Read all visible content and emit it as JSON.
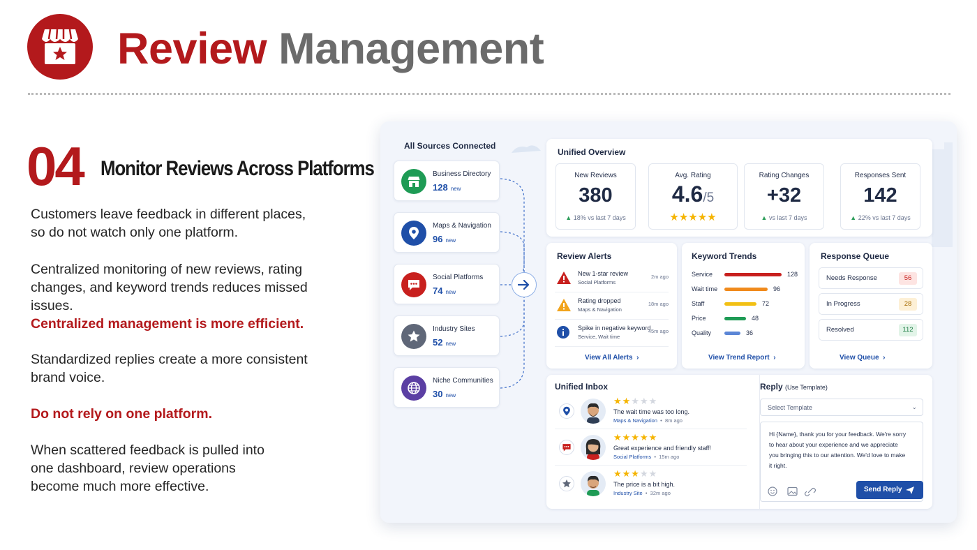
{
  "header": {
    "title_part1": "Review",
    "title_part2": "Management",
    "logo_icon": "storefront-star-icon"
  },
  "section": {
    "number": "04",
    "heading": "Monitor Reviews Across Platforms"
  },
  "paragraphs": {
    "p1": "Customers leave feedback in different places, so do not watch only one platform.",
    "p2": "Centralized monitoring of new reviews, rating changes, and keyword trends reduces missed issues.",
    "p2_emphasis": "Centralized management is more efficient.",
    "p3": "Standardized replies create a more consistent brand voice.",
    "p4_emphasis": "Do not rely on one platform.",
    "p5": "When scattered feedback is pulled into one dashboard, review operations become much more effective."
  },
  "colors": {
    "brand_red": "#b3191c",
    "accent_blue": "#1f4fa8",
    "star": "#f5b400",
    "green": "#2e9e5b"
  },
  "sources": {
    "title": "All Sources Connected",
    "new_label": "new",
    "items": [
      {
        "name": "Business Directory",
        "count": "128",
        "icon": "storefront-icon",
        "color": "#1e9b55"
      },
      {
        "name": "Maps & Navigation",
        "count": "96",
        "icon": "map-pin-icon",
        "color": "#1f4fa8"
      },
      {
        "name": "Social Platforms",
        "count": "74",
        "icon": "chat-bubble-icon",
        "color": "#c8201e"
      },
      {
        "name": "Industry Sites",
        "count": "52",
        "icon": "star-icon",
        "color": "#5f6778"
      },
      {
        "name": "Niche Communities",
        "count": "30",
        "icon": "globe-icon",
        "color": "#5b3fa3"
      }
    ]
  },
  "overview": {
    "title": "Unified Overview",
    "metrics": [
      {
        "label": "New Reviews",
        "value": "380",
        "delta": "18%",
        "delta_suffix": "vs last 7 days"
      },
      {
        "label": "Avg. Rating",
        "value": "4.6",
        "value_suffix": "/5",
        "stars": "★★★★★",
        "rating": 4.6
      },
      {
        "label": "Rating Changes",
        "value": "+32",
        "delta": "",
        "delta_suffix": "vs last 7 days"
      },
      {
        "label": "Responses Sent",
        "value": "142",
        "delta": "22%",
        "delta_suffix": "vs last 7 days"
      }
    ]
  },
  "alerts": {
    "title": "Review Alerts",
    "items": [
      {
        "title": "New 1-star review",
        "source": "Social Platforms",
        "age": "2m ago",
        "icon": "error-triangle-icon"
      },
      {
        "title": "Rating dropped",
        "source": "Maps & Navigation",
        "age": "18m ago",
        "icon": "warning-triangle-icon"
      },
      {
        "title": "Spike in negative keyword",
        "source": "Service, Wait time",
        "age": "45m ago",
        "icon": "info-icon"
      }
    ],
    "link": "View All Alerts"
  },
  "keywords": {
    "title": "Keyword Trends",
    "items": [
      {
        "name": "Service",
        "value": 128,
        "label": "128",
        "color": "#c8201e"
      },
      {
        "name": "Wait time",
        "value": 96,
        "label": "96",
        "color": "#f08a1c"
      },
      {
        "name": "Staff",
        "value": 72,
        "label": "72",
        "color": "#f2c014"
      },
      {
        "name": "Price",
        "value": 48,
        "label": "48",
        "color": "#1e9b55"
      },
      {
        "name": "Quality",
        "value": 36,
        "label": "36",
        "color": "#5b86d6"
      }
    ],
    "link": "View Trend Report"
  },
  "queue": {
    "title": "Response Queue",
    "items": [
      {
        "name": "Needs Response",
        "count": "56",
        "bg": "#fde4e2",
        "fg": "#c8201e"
      },
      {
        "name": "In Progress",
        "count": "28",
        "bg": "#fdf0d6",
        "fg": "#a66a00"
      },
      {
        "name": "Resolved",
        "count": "112",
        "bg": "#e2f4e8",
        "fg": "#1e7d45"
      }
    ],
    "link": "View Queue"
  },
  "inbox": {
    "title": "Unified Inbox",
    "messages": [
      {
        "rating": 2,
        "stars_on": "★★",
        "stars_off": "★★★",
        "text": "The wait time was too long.",
        "source": "Maps & Navigation",
        "age": "8m ago",
        "icon": "map-pin-icon"
      },
      {
        "rating": 5,
        "stars_on": "★★★★★",
        "stars_off": "",
        "text": "Great experience and friendly staff!",
        "source": "Social Platforms",
        "age": "15m ago",
        "icon": "chat-bubble-icon"
      },
      {
        "rating": 3,
        "stars_on": "★★★",
        "stars_off": "★★",
        "text": "The price is a bit high.",
        "source": "Industry Site",
        "age": "32m ago",
        "icon": "star-icon"
      }
    ]
  },
  "reply": {
    "title": "Reply",
    "title_hint": "(Use Template)",
    "select_placeholder": "Select Template",
    "body": "Hi {Name}, thank you for your feedback. We're sorry to hear about your experience and we appreciate you bringing this to our attention. We'd love to make it right.",
    "send_label": "Send Reply",
    "dot": "•"
  }
}
